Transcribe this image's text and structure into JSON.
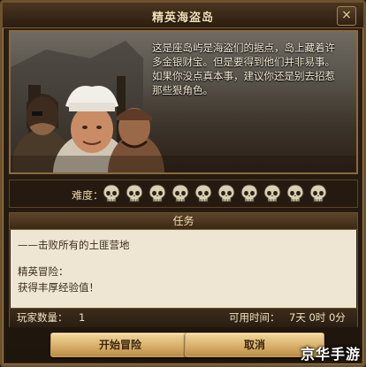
{
  "dialog": {
    "title": "精英海盗岛",
    "close_label": "×",
    "story_lines": [
      "这是座岛屿是海盗们的据点，岛上藏着许",
      "多金银财宝。但是要得到他们并非易事。",
      "如果你没点真本事，建议你还是别去招惹",
      "那些狠角色。"
    ]
  },
  "difficulty": {
    "label": "难度：",
    "level": 10,
    "max": 10,
    "icon": "skull-icon"
  },
  "task": {
    "header": "任务",
    "objective": "——击败所有的土匪营地",
    "reward_title": "精英冒险：",
    "reward_text": "获得丰厚经验值！",
    "players_label": "玩家数量：",
    "players_value": "1",
    "time_label": "可用时间：",
    "time_value": "7天 0时 0分"
  },
  "buttons": {
    "start": "开始冒险",
    "cancel": "取消"
  },
  "watermark": "京华手游",
  "colors": {
    "frame": "#6d5230",
    "title_text": "#f3dfb3",
    "button": "#d8b06a",
    "panel_bg": "#eee6d2"
  }
}
